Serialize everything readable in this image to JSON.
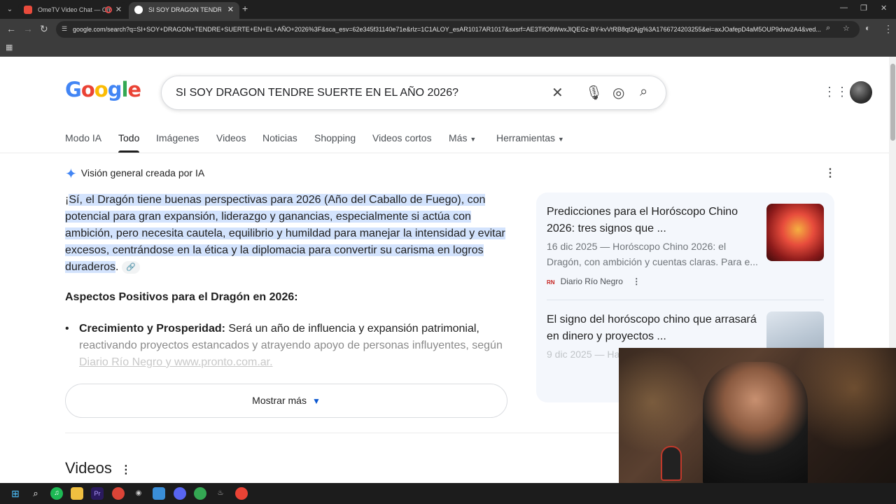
{
  "browser": {
    "tabs": [
      {
        "title": "OmeTV Video Chat — Ome"
      },
      {
        "title": "SI SOY DRAGON TENDRE SUER"
      }
    ],
    "url": "google.com/search?q=SI+SOY+DRAGON+TENDRE+SUERTE+EN+EL+AÑO+2026%3F&sca_esv=62e345f31140e71e&rlz=1C1ALOY_esAR1017AR1017&sxsrf=AE3TifO8WwxJlQEGz-BY-kvVtRB8qt2Ajg%3A1766724203255&ei=axJOafepD4aM5OUP9dvw2A4&ved..."
  },
  "search": {
    "logo": "Google",
    "query": "SI SOY DRAGON TENDRE SUERTE EN EL AÑO 2026?"
  },
  "nav_tabs": [
    "Modo IA",
    "Todo",
    "Imágenes",
    "Videos",
    "Noticias",
    "Shopping",
    "Videos cortos",
    "Más",
    "Herramientas"
  ],
  "ai_overview": {
    "header": "Visión general creada por IA",
    "paragraph_lead": "¡",
    "paragraph": "Sí, el Dragón tiene buenas perspectivas para 2026 (Año del Caballo de Fuego), con potencial para gran expansión, liderazgo y ganancias, especialmente si actúa con ambición, pero necesita cautela, equilibrio y humildad para manejar la intensidad y evitar excesos, centrándose en la ética y la diplomacia para convertir su carisma en logros duraderos",
    "paragraph_end": ".",
    "subheading": "Aspectos Positivos para el Dragón en 2026:",
    "bullet_title": "Crecimiento y Prosperidad:",
    "bullet_text": " Será un año de influencia y expansión patrimonial,",
    "bullet_faded": "reactivando proyectos estancados y atrayendo apoyo de personas influyentes, según",
    "bullet_links": "Diario Río Negro y www.pronto.com.ar.",
    "show_more": "Mostrar más"
  },
  "side_cards": [
    {
      "title": "Predicciones para el Horóscopo Chino 2026: tres signos que ...",
      "snippet": "16 dic 2025 — Horóscopo Chino 2026: el Dragón, con ambición y cuentas claras. Para e...",
      "source": "Diario Río Negro",
      "source_icon": "RN"
    },
    {
      "title": "El signo del horóscopo chino que arrasará en dinero y proyectos ...",
      "snippet": "9 dic 2025 — Ha",
      "source": "",
      "source_icon": ""
    }
  ],
  "videos_section": {
    "title": "Videos"
  },
  "colors": {
    "highlight": "#d3e3fd",
    "google_blue": "#4285f4",
    "accent": "#0b57d0"
  }
}
